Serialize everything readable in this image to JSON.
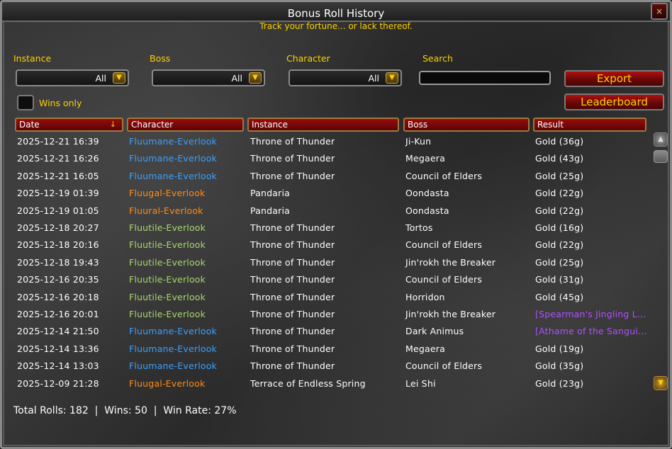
{
  "window": {
    "title": "Bonus Roll History",
    "subtitle": "Track your fortune... or lack thereof.",
    "close_icon": "×"
  },
  "filters": {
    "instance": {
      "label": "Instance",
      "value": "All"
    },
    "boss": {
      "label": "Boss",
      "value": "All"
    },
    "character": {
      "label": "Character",
      "value": "All"
    },
    "search": {
      "label": "Search",
      "value": ""
    }
  },
  "buttons": {
    "export": "Export",
    "leaderboard": "Leaderboard"
  },
  "wins_only": {
    "label": "Wins only",
    "checked": false
  },
  "columns": [
    "Date",
    "Character",
    "Instance",
    "Boss",
    "Result"
  ],
  "sort_arrow": "↓",
  "colors": {
    "blue": "#3aa0ff",
    "orange": "#ff8c1a",
    "green": "#a8d86a",
    "purple": "#b050ff",
    "white": "#ffffff",
    "gold": "#ffd100"
  },
  "rows": [
    {
      "date": "2025-12-21 16:39",
      "character": "Fluumane-Everlook",
      "char_color": "#3aa0ff",
      "instance": "Throne of Thunder",
      "boss": "Ji-Kun",
      "result": "Gold (36g)",
      "result_color": "#ffffff"
    },
    {
      "date": "2025-12-21 16:26",
      "character": "Fluumane-Everlook",
      "char_color": "#3aa0ff",
      "instance": "Throne of Thunder",
      "boss": "Megaera",
      "result": "Gold (43g)",
      "result_color": "#ffffff"
    },
    {
      "date": "2025-12-21 16:05",
      "character": "Fluumane-Everlook",
      "char_color": "#3aa0ff",
      "instance": "Throne of Thunder",
      "boss": "Council of Elders",
      "result": "Gold (25g)",
      "result_color": "#ffffff"
    },
    {
      "date": "2025-12-19 01:39",
      "character": "Fluugal-Everlook",
      "char_color": "#ff8c1a",
      "instance": "Pandaria",
      "boss": "Oondasta",
      "result": "Gold (22g)",
      "result_color": "#ffffff"
    },
    {
      "date": "2025-12-19 01:05",
      "character": "Fluural-Everlook",
      "char_color": "#ff8c1a",
      "instance": "Pandaria",
      "boss": "Oondasta",
      "result": "Gold (22g)",
      "result_color": "#ffffff"
    },
    {
      "date": "2025-12-18 20:27",
      "character": "Fluutile-Everlook",
      "char_color": "#a8d86a",
      "instance": "Throne of Thunder",
      "boss": "Tortos",
      "result": "Gold (16g)",
      "result_color": "#ffffff"
    },
    {
      "date": "2025-12-18 20:16",
      "character": "Fluutile-Everlook",
      "char_color": "#a8d86a",
      "instance": "Throne of Thunder",
      "boss": "Council of Elders",
      "result": "Gold (22g)",
      "result_color": "#ffffff"
    },
    {
      "date": "2025-12-18 19:43",
      "character": "Fluutile-Everlook",
      "char_color": "#a8d86a",
      "instance": "Throne of Thunder",
      "boss": "Jin'rokh the Breaker",
      "result": "Gold (25g)",
      "result_color": "#ffffff"
    },
    {
      "date": "2025-12-16 20:35",
      "character": "Fluutile-Everlook",
      "char_color": "#a8d86a",
      "instance": "Throne of Thunder",
      "boss": "Council of Elders",
      "result": "Gold (31g)",
      "result_color": "#ffffff"
    },
    {
      "date": "2025-12-16 20:18",
      "character": "Fluutile-Everlook",
      "char_color": "#a8d86a",
      "instance": "Throne of Thunder",
      "boss": "Horridon",
      "result": "Gold (45g)",
      "result_color": "#ffffff"
    },
    {
      "date": "2025-12-16 20:01",
      "character": "Fluutile-Everlook",
      "char_color": "#a8d86a",
      "instance": "Throne of Thunder",
      "boss": "Jin'rokh the Breaker",
      "result": "[Spearman's Jingling L...",
      "result_color": "#b050ff"
    },
    {
      "date": "2025-12-14 21:50",
      "character": "Fluumane-Everlook",
      "char_color": "#3aa0ff",
      "instance": "Throne of Thunder",
      "boss": "Dark Animus",
      "result": "[Athame of the Sangui...",
      "result_color": "#b050ff"
    },
    {
      "date": "2025-12-14 13:36",
      "character": "Fluumane-Everlook",
      "char_color": "#3aa0ff",
      "instance": "Throne of Thunder",
      "boss": "Megaera",
      "result": "Gold (19g)",
      "result_color": "#ffffff"
    },
    {
      "date": "2025-12-14 13:03",
      "character": "Fluumane-Everlook",
      "char_color": "#3aa0ff",
      "instance": "Throne of Thunder",
      "boss": "Council of Elders",
      "result": "Gold (35g)",
      "result_color": "#ffffff"
    },
    {
      "date": "2025-12-09 21:28",
      "character": "Fluugal-Everlook",
      "char_color": "#ff8c1a",
      "instance": "Terrace of Endless Spring",
      "boss": "Lei Shi",
      "result": "Gold (23g)",
      "result_color": "#ffffff"
    }
  ],
  "footer": {
    "text": "Total Rolls: 182  |  Wins: 50  |  Win Rate: 27%"
  }
}
